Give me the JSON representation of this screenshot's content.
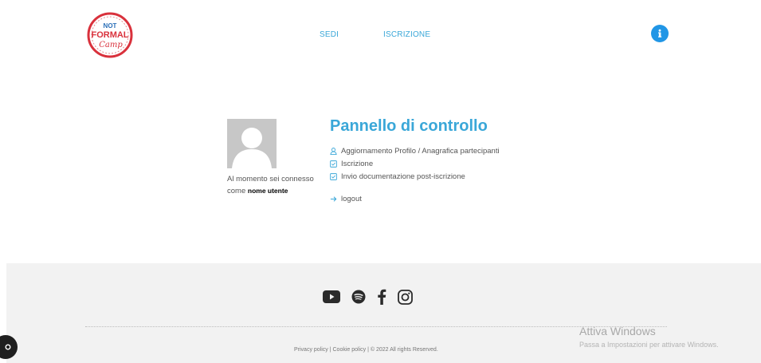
{
  "header": {
    "logo_text": [
      "NOT",
      "FORMAL",
      "Camp"
    ],
    "nav": [
      {
        "label": "SEDI"
      },
      {
        "label": "ISCRIZIONE"
      }
    ],
    "info_icon": "info-icon"
  },
  "profile": {
    "connected_text": "Al momento sei connesso come",
    "username": "nome utente"
  },
  "panel": {
    "title": "Pannello di controllo",
    "items": [
      {
        "icon": "user-icon",
        "label": "Aggiornamento Profilo / Anagrafica partecipanti"
      },
      {
        "icon": "checkbox-icon",
        "label": "Iscrizione"
      },
      {
        "icon": "checkbox-icon",
        "label": "Invio documentazione post-iscrizione"
      }
    ],
    "logout": "logout"
  },
  "footer": {
    "social": [
      "youtube-icon",
      "spotify-icon",
      "facebook-icon",
      "instagram-icon"
    ],
    "copyright": "Privacy policy | Cookie policy | © 2022 All rights Reserved."
  },
  "watermark": {
    "title": "Attiva Windows",
    "subtitle": "Passa a Impostazioni per attivare Windows."
  },
  "colors": {
    "accent": "#3aa7d8",
    "info": "#2196e6",
    "logo_red": "#d9313c",
    "footer_bg": "#f2f2f2"
  }
}
